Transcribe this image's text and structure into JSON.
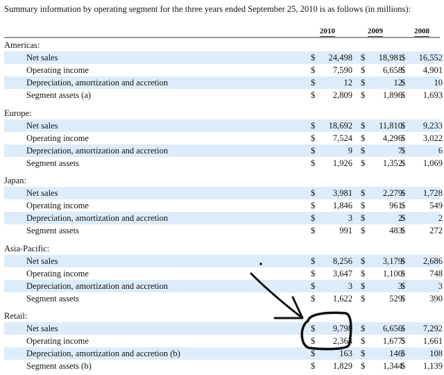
{
  "intro": "Summary information by operating segment for the three years ended September 25, 2010 is as follows (in millions):",
  "years": [
    "2010",
    "2009",
    "2008"
  ],
  "segments": [
    {
      "name": "Americas:",
      "rows": [
        {
          "label": "Net sales",
          "values": [
            {
              "cur": "$",
              "num": "24,498"
            },
            {
              "cur": "$",
              "num": "18,981"
            },
            {
              "cur": "$",
              "num": "16,552"
            }
          ]
        },
        {
          "label": "Operating income",
          "values": [
            {
              "cur": "$",
              "num": "7,590"
            },
            {
              "cur": "$",
              "num": "6,658"
            },
            {
              "cur": "$",
              "num": "4,901"
            }
          ]
        },
        {
          "label": "Depreciation, amortization and accretion",
          "values": [
            {
              "cur": "$",
              "num": "12"
            },
            {
              "cur": "$",
              "num": "12"
            },
            {
              "cur": "$",
              "num": "10"
            }
          ]
        },
        {
          "label": "Segment assets (a)",
          "values": [
            {
              "cur": "$",
              "num": "2,809"
            },
            {
              "cur": "$",
              "num": "1,896"
            },
            {
              "cur": "$",
              "num": "1,693"
            }
          ]
        }
      ]
    },
    {
      "name": "Europe:",
      "rows": [
        {
          "label": "Net sales",
          "values": [
            {
              "cur": "$",
              "num": "18,692"
            },
            {
              "cur": "$",
              "num": "11,810"
            },
            {
              "cur": "$",
              "num": "9,233"
            }
          ]
        },
        {
          "label": "Operating income",
          "values": [
            {
              "cur": "$",
              "num": "7,524"
            },
            {
              "cur": "$",
              "num": "4,296"
            },
            {
              "cur": "$",
              "num": "3,022"
            }
          ]
        },
        {
          "label": "Depreciation, amortization and accretion",
          "values": [
            {
              "cur": "$",
              "num": "9"
            },
            {
              "cur": "$",
              "num": "7"
            },
            {
              "cur": "$",
              "num": "6"
            }
          ]
        },
        {
          "label": "Segment assets",
          "values": [
            {
              "cur": "$",
              "num": "1,926"
            },
            {
              "cur": "$",
              "num": "1,352"
            },
            {
              "cur": "$",
              "num": "1,069"
            }
          ]
        }
      ]
    },
    {
      "name": "Japan:",
      "rows": [
        {
          "label": "Net sales",
          "values": [
            {
              "cur": "$",
              "num": "3,981"
            },
            {
              "cur": "$",
              "num": "2,279"
            },
            {
              "cur": "$",
              "num": "1,728"
            }
          ]
        },
        {
          "label": "Operating income",
          "values": [
            {
              "cur": "$",
              "num": "1,846"
            },
            {
              "cur": "$",
              "num": "961"
            },
            {
              "cur": "$",
              "num": "549"
            }
          ]
        },
        {
          "label": "Depreciation, amortization and accretion",
          "values": [
            {
              "cur": "$",
              "num": "3"
            },
            {
              "cur": "$",
              "num": "2"
            },
            {
              "cur": "$",
              "num": "2"
            }
          ]
        },
        {
          "label": "Segment assets",
          "values": [
            {
              "cur": "$",
              "num": "991"
            },
            {
              "cur": "$",
              "num": "483"
            },
            {
              "cur": "$",
              "num": "272"
            }
          ]
        }
      ]
    },
    {
      "name": "Asia-Pacific:",
      "rows": [
        {
          "label": "Net sales",
          "values": [
            {
              "cur": "$",
              "num": "8,256"
            },
            {
              "cur": "$",
              "num": "3,179"
            },
            {
              "cur": "$",
              "num": "2,686"
            }
          ]
        },
        {
          "label": "Operating income",
          "values": [
            {
              "cur": "$",
              "num": "3,647"
            },
            {
              "cur": "$",
              "num": "1,100"
            },
            {
              "cur": "$",
              "num": "748"
            }
          ]
        },
        {
          "label": "Depreciation, amortization and accretion",
          "values": [
            {
              "cur": "$",
              "num": "3"
            },
            {
              "cur": "$",
              "num": "3"
            },
            {
              "cur": "$",
              "num": "3"
            }
          ]
        },
        {
          "label": "Segment assets",
          "values": [
            {
              "cur": "$",
              "num": "1,622"
            },
            {
              "cur": "$",
              "num": "529"
            },
            {
              "cur": "$",
              "num": "390"
            }
          ]
        }
      ]
    },
    {
      "name": "Retail:",
      "rows": [
        {
          "label": "Net sales",
          "values": [
            {
              "cur": "$",
              "num": "9,798"
            },
            {
              "cur": "$",
              "num": "6,656"
            },
            {
              "cur": "$",
              "num": "7,292"
            }
          ]
        },
        {
          "label": "Operating income",
          "values": [
            {
              "cur": "$",
              "num": "2,364"
            },
            {
              "cur": "$",
              "num": "1,677"
            },
            {
              "cur": "$",
              "num": "1,661"
            }
          ]
        },
        {
          "label": "Depreciation, amortization and accretion (b)",
          "values": [
            {
              "cur": "$",
              "num": "163"
            },
            {
              "cur": "$",
              "num": "146"
            },
            {
              "cur": "$",
              "num": "108"
            }
          ]
        },
        {
          "label": "Segment assets (b)",
          "values": [
            {
              "cur": "$",
              "num": "1,829"
            },
            {
              "cur": "$",
              "num": "1,344"
            },
            {
              "cur": "$",
              "num": "1,139"
            }
          ]
        }
      ]
    }
  ],
  "annotation": {
    "type": "hand-drawn arrow and circle",
    "color": "#000000",
    "highlighted": [
      "9,798",
      "2,364"
    ]
  }
}
